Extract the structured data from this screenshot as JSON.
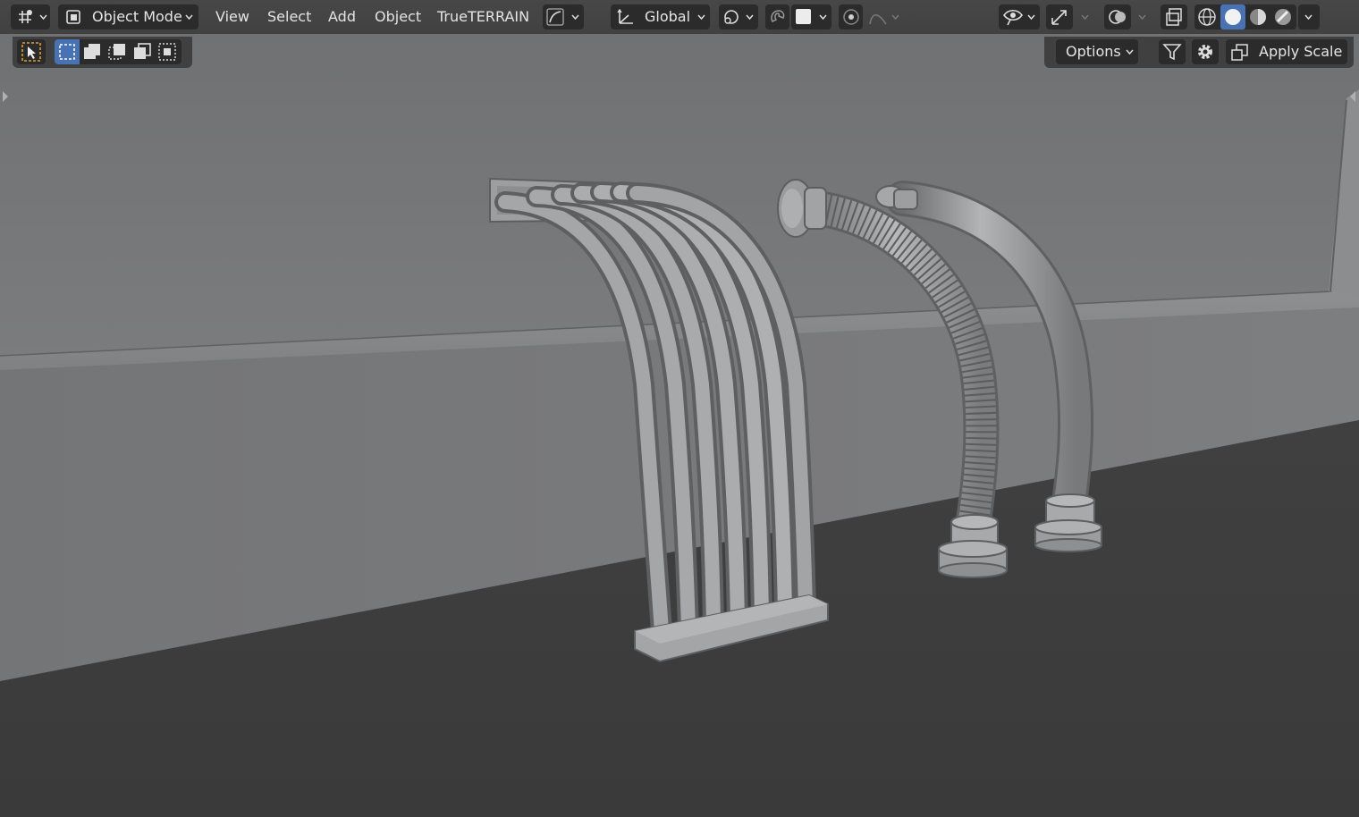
{
  "header": {
    "mode": {
      "label": "Object Mode",
      "icon": "object-mode-icon"
    },
    "menus": [
      "View",
      "Select",
      "Add",
      "Object",
      "TrueTERRAIN"
    ],
    "transform_orientation": "Global",
    "icons": {
      "editor_type": "editor-type-icon",
      "curve_pivot": "curve-icon",
      "orientation": "transform-orientation-icon",
      "snap": "snap-icon",
      "snap_target": "snap-increment-icon",
      "proportional": "proportional-edit-icon",
      "falloff": "falloff-curve-icon",
      "visibility": "eye-icon",
      "gizmo": "gizmo-icon",
      "overlays": "overlays-icon",
      "xray": "xray-icon",
      "shading_wire": "wireframe-shading-icon",
      "shading_solid": "solid-shading-icon",
      "shading_material": "material-shading-icon",
      "shading_rendered": "rendered-shading-icon"
    }
  },
  "toolbar": {
    "tool_icons": [
      "select-tool-icon",
      "box-select-new-icon",
      "box-select-extend-icon",
      "box-select-subtract-icon",
      "box-select-invert-icon",
      "box-select-intersect-icon"
    ]
  },
  "right_panel": {
    "options_label": "Options",
    "apply_label": "Apply Scale",
    "icons": {
      "filter": "filter-icon",
      "settings": "gear-icon",
      "apply": "apply-scale-icon"
    }
  },
  "colors": {
    "header_bg": "#444444",
    "button_bg": "#2b2b2b",
    "accent_blue": "#4772b3",
    "wall": "#7a7b7d",
    "floor": "#3d3d3d"
  }
}
